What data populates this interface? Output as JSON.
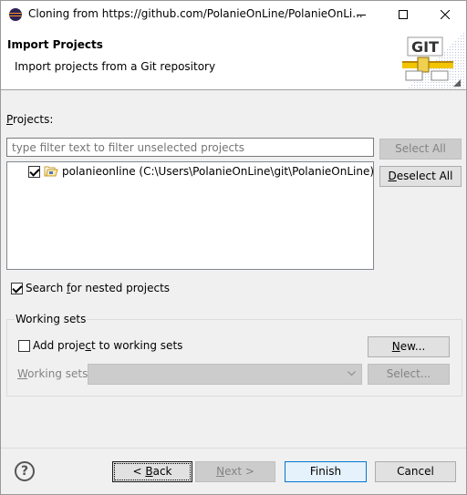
{
  "window": {
    "title": "Cloning from https://github.com/PolanieOnLine/PolanieOnLi..."
  },
  "banner": {
    "title": "Import Projects",
    "description": "Import projects from a Git repository",
    "logo_text": "GIT"
  },
  "projects": {
    "label_mnemonic": "P",
    "label_rest": "rojects:",
    "filter_placeholder": "type filter text to filter unselected projects",
    "filter_value": "",
    "items": [
      {
        "label": "polanieonline (C:\\Users\\PolanieOnLine\\git\\PolanieOnLine)",
        "checked": true,
        "icon": "folder-icon"
      }
    ],
    "select_all_label": "Select All",
    "deselect_all_mnemonic": "D",
    "deselect_all_rest": "eselect All"
  },
  "nested": {
    "label_pre": "Search ",
    "label_mnemonic": "f",
    "label_post": "or nested projects",
    "checked": true
  },
  "working_sets": {
    "group_label": "Working sets",
    "add_pre": "Add proje",
    "add_mnemonic": "c",
    "add_post": "t to working sets",
    "add_checked": false,
    "new_pre": "",
    "new_mnemonic": "N",
    "new_post": "ew...",
    "sets_mnemonic": "W",
    "sets_rest": "orking sets:",
    "combo_value": "",
    "select_label": "Select..."
  },
  "footer": {
    "back_pre": "< ",
    "back_mnemonic": "B",
    "back_post": "ack",
    "next_pre": "",
    "next_mnemonic": "N",
    "next_post": "ext >",
    "finish_label": "Finish",
    "cancel_label": "Cancel"
  },
  "colors": {
    "accent": "#0078d7",
    "disabled_text": "#838383"
  }
}
